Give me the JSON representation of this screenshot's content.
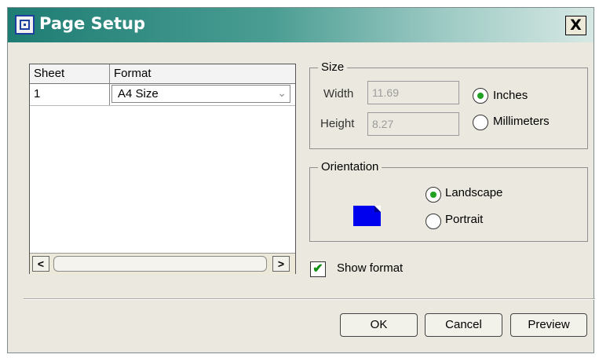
{
  "window": {
    "title": "Page Setup",
    "close_glyph": "X",
    "icon": "page-setup-icon"
  },
  "table": {
    "columns": [
      "Sheet",
      "Format"
    ],
    "rows": [
      {
        "sheet": "1",
        "format": "A4 Size"
      }
    ],
    "scroll_left": "<",
    "scroll_right": ">"
  },
  "size": {
    "legend": "Size",
    "width_label": "Width",
    "width_value": "11.69",
    "height_label": "Height",
    "height_value": "8.27",
    "units": [
      {
        "label": "Inches",
        "selected": true
      },
      {
        "label": "Millimeters",
        "selected": false
      }
    ]
  },
  "orientation": {
    "legend": "Orientation",
    "options": [
      {
        "label": "Landscape",
        "selected": true
      },
      {
        "label": "Portrait",
        "selected": false
      }
    ]
  },
  "show_format": {
    "label": "Show format",
    "checked": true,
    "glyph": "✔"
  },
  "buttons": {
    "ok": "OK",
    "cancel": "Cancel",
    "preview": "Preview"
  },
  "colors": {
    "accent": "#1e7d73",
    "radio_dot": "#21a121",
    "orientation_icon": "#0000ee"
  }
}
